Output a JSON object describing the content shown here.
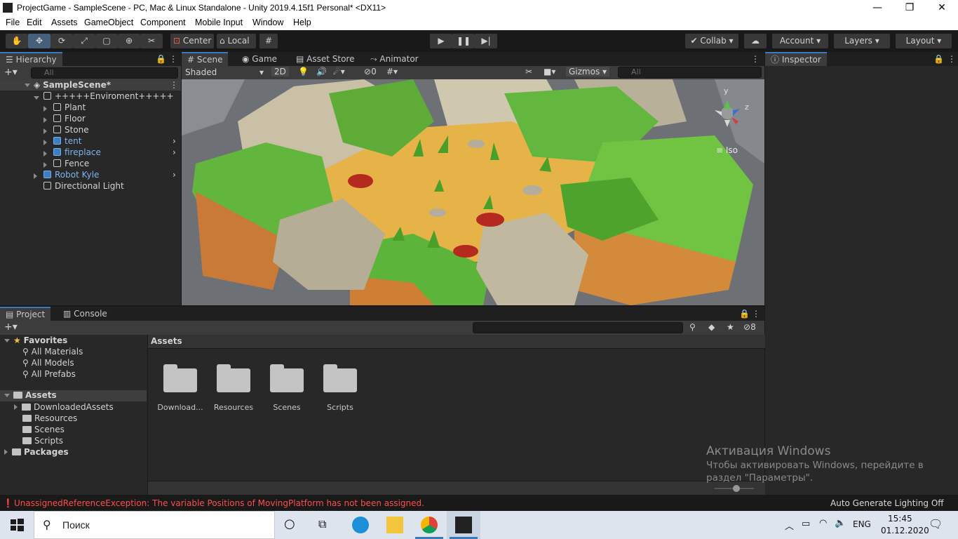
{
  "window": {
    "title": "ProjectGame - SampleScene - PC, Mac & Linux Standalone - Unity 2019.4.15f1 Personal* <DX11>",
    "minimize": "—",
    "maximize": "❐",
    "close": "✕"
  },
  "menu": [
    "File",
    "Edit",
    "Assets",
    "GameObject",
    "Component",
    "Mobile Input",
    "Window",
    "Help"
  ],
  "toolbar": {
    "pivot_label": "Center",
    "space_label": "Local",
    "collab_label": "Collab",
    "account_label": "Account",
    "layers_label": "Layers",
    "layout_label": "Layout"
  },
  "hierarchy": {
    "tab_label": "Hierarchy",
    "search_placeholder": "All",
    "scene_name": "SampleScene*",
    "items": [
      {
        "label": "+++++Enviroment+++++",
        "indent": 1,
        "expanded": true,
        "prefab": false
      },
      {
        "label": "Plant",
        "indent": 2,
        "prefab": false
      },
      {
        "label": "Floor",
        "indent": 2,
        "prefab": false
      },
      {
        "label": "Stone",
        "indent": 2,
        "prefab": false
      },
      {
        "label": "tent",
        "indent": 2,
        "prefab": true
      },
      {
        "label": "fireplace",
        "indent": 2,
        "prefab": true
      },
      {
        "label": "Fence",
        "indent": 2,
        "prefab": false
      },
      {
        "label": "Robot Kyle",
        "indent": 1,
        "prefab": true
      },
      {
        "label": "Directional Light",
        "indent": 1,
        "prefab": false
      }
    ]
  },
  "scene_tabs": [
    "Scene",
    "Game",
    "Asset Store",
    "Animator"
  ],
  "scene_toolbar": {
    "draw_mode": "Shaded",
    "mode_2d": "2D",
    "hidden_count": "0",
    "gizmos_label": "Gizmos",
    "search_placeholder": "All",
    "projection": "Iso",
    "axis_y": "y",
    "axis_z": "z"
  },
  "inspector": {
    "tab_label": "Inspector"
  },
  "project": {
    "tabs": [
      "Project",
      "Console"
    ],
    "favorites_label": "Favorites",
    "favorites": [
      "All Materials",
      "All Models",
      "All Prefabs"
    ],
    "assets_label": "Assets",
    "asset_folders": [
      "DownloadedAssets",
      "Resources",
      "Scenes",
      "Scripts"
    ],
    "packages_label": "Packages",
    "breadcrumb": "Assets",
    "grid_items": [
      "Download...",
      "Resources",
      "Scenes",
      "Scripts"
    ],
    "hidden_packages": "8"
  },
  "status": {
    "error": "UnassignedReferenceException: The variable Positions of MovingPlatform has not been assigned.",
    "lighting": "Auto Generate Lighting Off"
  },
  "watermark": {
    "title": "Активация Windows",
    "line1": "Чтобы активировать Windows, перейдите в",
    "line2": "раздел \"Параметры\"."
  },
  "taskbar": {
    "search_label": "Поиск",
    "lang": "ENG",
    "time": "15:45",
    "date": "01.12.2020"
  },
  "colors": {
    "accent": "#3a79bb",
    "error": "#ff4c4c",
    "prefab": "#7cb4f0"
  }
}
